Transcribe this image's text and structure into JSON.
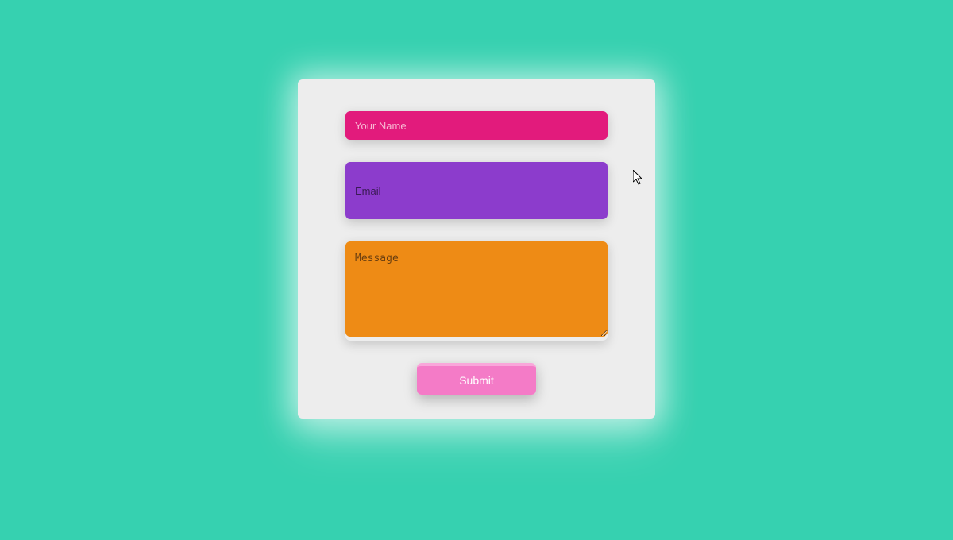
{
  "form": {
    "name": {
      "placeholder": "Your Name",
      "value": ""
    },
    "email": {
      "placeholder": "Email",
      "value": ""
    },
    "message": {
      "placeholder": "Message",
      "value": ""
    },
    "submit_label": "Submit"
  },
  "colors": {
    "background": "#36d1b0",
    "card": "#ededed",
    "name_field": "#e21b7c",
    "email_field": "#8c3ccc",
    "message_field": "#ee8b15",
    "submit": "#f47bc7"
  }
}
